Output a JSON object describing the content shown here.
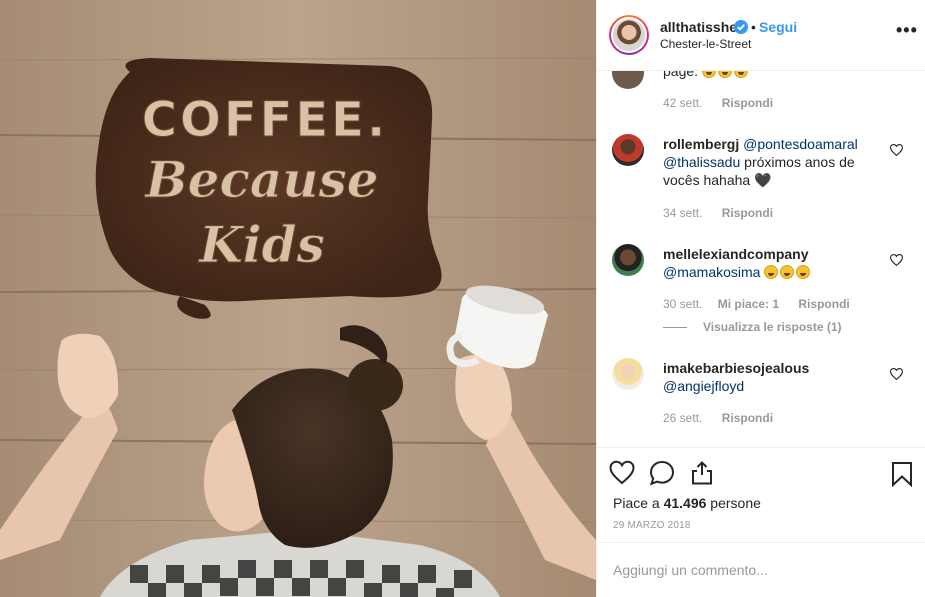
{
  "photo": {
    "sign_lines": [
      "COFFEE.",
      "Because",
      "Kids"
    ]
  },
  "header": {
    "username": "allthatisshe",
    "separator": "•",
    "follow_label": "Segui",
    "location": "Chester-le-Street",
    "more_label": "•••"
  },
  "comments": [
    {
      "username": "",
      "text_partial": "page.",
      "emojis": 3,
      "time": "42 sett.",
      "reply_label": "Rispondi"
    },
    {
      "username": "rollembergj",
      "mention1": "@pontesdoamaral",
      "mention2": "@thalissadu",
      "text": " próximos anos de vocês hahaha",
      "emoji_end": "🖤",
      "time": "34 sett.",
      "reply_label": "Rispondi"
    },
    {
      "username": "mellelexiandcompany",
      "mention1": "@mamakosima",
      "emojis": 3,
      "time": "30 sett.",
      "likes_label": "Mi piace: 1",
      "reply_label": "Rispondi",
      "view_replies": "Visualizza le risposte (1)"
    },
    {
      "username": "imakebarbiesojealous",
      "mention1": "@angiejfloyd",
      "time": "26 sett.",
      "reply_label": "Rispondi"
    }
  ],
  "actions": {
    "likes_prefix": "Piace a ",
    "likes_count": "41.496",
    "likes_suffix": " persone",
    "date": "29 MARZO 2018"
  },
  "add_comment": {
    "placeholder": "Aggiungi un commento..."
  },
  "colors": {
    "link_blue": "#3897f0",
    "mention": "#003569",
    "muted": "#999999",
    "text": "#262626"
  },
  "icons": [
    "verified-badge-icon",
    "more-options-icon",
    "heart-icon",
    "comment-icon",
    "share-icon",
    "bookmark-icon"
  ]
}
